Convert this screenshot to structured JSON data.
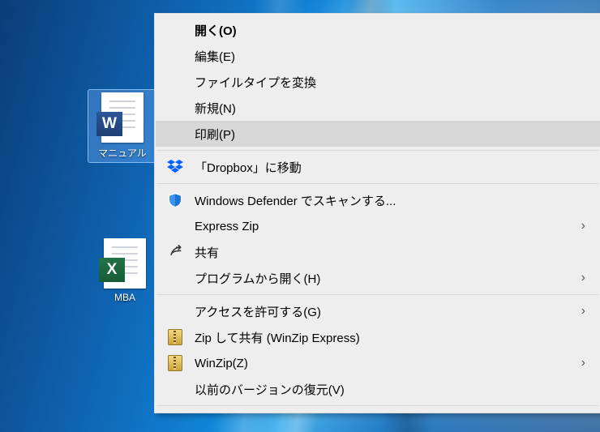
{
  "desktop": {
    "icons": [
      {
        "label": "マニュアル",
        "badge_letter": "W",
        "app": "word",
        "selected": true
      },
      {
        "label": "MBA",
        "badge_letter": "X",
        "app": "excel",
        "selected": false
      }
    ]
  },
  "context_menu": {
    "items": [
      {
        "label": "開く(O)",
        "bold": true
      },
      {
        "label": "編集(E)"
      },
      {
        "label": "ファイルタイプを変換"
      },
      {
        "label": "新規(N)"
      },
      {
        "label": "印刷(P)",
        "hovered": true
      },
      {
        "sep": true
      },
      {
        "label": "「Dropbox」に移動",
        "icon": "dropbox"
      },
      {
        "sep": true
      },
      {
        "label": "Windows Defender でスキャンする...",
        "icon": "shield"
      },
      {
        "label": "Express Zip",
        "submenu": true
      },
      {
        "label": "共有",
        "icon": "share"
      },
      {
        "label": "プログラムから開く(H)",
        "submenu": true
      },
      {
        "sep": true
      },
      {
        "label": "アクセスを許可する(G)",
        "submenu": true
      },
      {
        "label": "Zip して共有 (WinZip Express)",
        "icon": "winzip"
      },
      {
        "label": "WinZip(Z)",
        "icon": "winzip",
        "submenu": true
      },
      {
        "label": "以前のバージョンの復元(V)"
      },
      {
        "sep": true
      }
    ]
  },
  "glyphs": {
    "submenu_arrow": "›"
  }
}
